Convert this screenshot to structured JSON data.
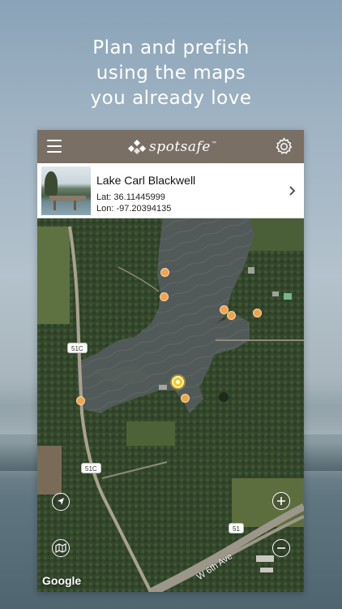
{
  "headline": {
    "line1": "Plan and prefish",
    "line2": "using the maps",
    "line3": "you already love"
  },
  "app": {
    "logo_text": "spotsafe",
    "logo_tm": "™"
  },
  "location": {
    "name": "Lake Carl Blackwell",
    "lat": "Lat: 36.11445999",
    "lon": "Lon: -97.20394135"
  },
  "map": {
    "roads": [
      "51C",
      "51C",
      "51"
    ],
    "street_label": "W 6th Ave",
    "attribution": "Google"
  },
  "icons": {
    "menu": "menu-icon",
    "settings": "gear-icon",
    "details": "chevron-right-icon",
    "locate": "navigation-arrow-icon",
    "layers": "map-layers-icon",
    "zoom_in": "plus-icon",
    "zoom_out": "minus-icon"
  },
  "colors": {
    "topbar": "#7a6f65",
    "pin": "#f0a44c",
    "pin_active": "#f2c91f"
  }
}
